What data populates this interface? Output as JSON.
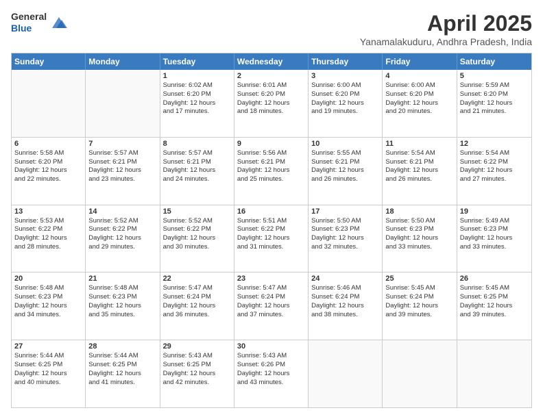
{
  "header": {
    "logo_line1": "General",
    "logo_line2": "Blue",
    "month": "April 2025",
    "location": "Yanamalakuduru, Andhra Pradesh, India"
  },
  "days_of_week": [
    "Sunday",
    "Monday",
    "Tuesday",
    "Wednesday",
    "Thursday",
    "Friday",
    "Saturday"
  ],
  "weeks": [
    [
      {
        "day": "",
        "empty": true
      },
      {
        "day": "",
        "empty": true
      },
      {
        "day": "1",
        "sunrise": "Sunrise: 6:02 AM",
        "sunset": "Sunset: 6:20 PM",
        "daylight": "Daylight: 12 hours and 17 minutes."
      },
      {
        "day": "2",
        "sunrise": "Sunrise: 6:01 AM",
        "sunset": "Sunset: 6:20 PM",
        "daylight": "Daylight: 12 hours and 18 minutes."
      },
      {
        "day": "3",
        "sunrise": "Sunrise: 6:00 AM",
        "sunset": "Sunset: 6:20 PM",
        "daylight": "Daylight: 12 hours and 19 minutes."
      },
      {
        "day": "4",
        "sunrise": "Sunrise: 6:00 AM",
        "sunset": "Sunset: 6:20 PM",
        "daylight": "Daylight: 12 hours and 20 minutes."
      },
      {
        "day": "5",
        "sunrise": "Sunrise: 5:59 AM",
        "sunset": "Sunset: 6:20 PM",
        "daylight": "Daylight: 12 hours and 21 minutes."
      }
    ],
    [
      {
        "day": "6",
        "sunrise": "Sunrise: 5:58 AM",
        "sunset": "Sunset: 6:20 PM",
        "daylight": "Daylight: 12 hours and 22 minutes."
      },
      {
        "day": "7",
        "sunrise": "Sunrise: 5:57 AM",
        "sunset": "Sunset: 6:21 PM",
        "daylight": "Daylight: 12 hours and 23 minutes."
      },
      {
        "day": "8",
        "sunrise": "Sunrise: 5:57 AM",
        "sunset": "Sunset: 6:21 PM",
        "daylight": "Daylight: 12 hours and 24 minutes."
      },
      {
        "day": "9",
        "sunrise": "Sunrise: 5:56 AM",
        "sunset": "Sunset: 6:21 PM",
        "daylight": "Daylight: 12 hours and 25 minutes."
      },
      {
        "day": "10",
        "sunrise": "Sunrise: 5:55 AM",
        "sunset": "Sunset: 6:21 PM",
        "daylight": "Daylight: 12 hours and 26 minutes."
      },
      {
        "day": "11",
        "sunrise": "Sunrise: 5:54 AM",
        "sunset": "Sunset: 6:21 PM",
        "daylight": "Daylight: 12 hours and 26 minutes."
      },
      {
        "day": "12",
        "sunrise": "Sunrise: 5:54 AM",
        "sunset": "Sunset: 6:22 PM",
        "daylight": "Daylight: 12 hours and 27 minutes."
      }
    ],
    [
      {
        "day": "13",
        "sunrise": "Sunrise: 5:53 AM",
        "sunset": "Sunset: 6:22 PM",
        "daylight": "Daylight: 12 hours and 28 minutes."
      },
      {
        "day": "14",
        "sunrise": "Sunrise: 5:52 AM",
        "sunset": "Sunset: 6:22 PM",
        "daylight": "Daylight: 12 hours and 29 minutes."
      },
      {
        "day": "15",
        "sunrise": "Sunrise: 5:52 AM",
        "sunset": "Sunset: 6:22 PM",
        "daylight": "Daylight: 12 hours and 30 minutes."
      },
      {
        "day": "16",
        "sunrise": "Sunrise: 5:51 AM",
        "sunset": "Sunset: 6:22 PM",
        "daylight": "Daylight: 12 hours and 31 minutes."
      },
      {
        "day": "17",
        "sunrise": "Sunrise: 5:50 AM",
        "sunset": "Sunset: 6:23 PM",
        "daylight": "Daylight: 12 hours and 32 minutes."
      },
      {
        "day": "18",
        "sunrise": "Sunrise: 5:50 AM",
        "sunset": "Sunset: 6:23 PM",
        "daylight": "Daylight: 12 hours and 33 minutes."
      },
      {
        "day": "19",
        "sunrise": "Sunrise: 5:49 AM",
        "sunset": "Sunset: 6:23 PM",
        "daylight": "Daylight: 12 hours and 33 minutes."
      }
    ],
    [
      {
        "day": "20",
        "sunrise": "Sunrise: 5:48 AM",
        "sunset": "Sunset: 6:23 PM",
        "daylight": "Daylight: 12 hours and 34 minutes."
      },
      {
        "day": "21",
        "sunrise": "Sunrise: 5:48 AM",
        "sunset": "Sunset: 6:23 PM",
        "daylight": "Daylight: 12 hours and 35 minutes."
      },
      {
        "day": "22",
        "sunrise": "Sunrise: 5:47 AM",
        "sunset": "Sunset: 6:24 PM",
        "daylight": "Daylight: 12 hours and 36 minutes."
      },
      {
        "day": "23",
        "sunrise": "Sunrise: 5:47 AM",
        "sunset": "Sunset: 6:24 PM",
        "daylight": "Daylight: 12 hours and 37 minutes."
      },
      {
        "day": "24",
        "sunrise": "Sunrise: 5:46 AM",
        "sunset": "Sunset: 6:24 PM",
        "daylight": "Daylight: 12 hours and 38 minutes."
      },
      {
        "day": "25",
        "sunrise": "Sunrise: 5:45 AM",
        "sunset": "Sunset: 6:24 PM",
        "daylight": "Daylight: 12 hours and 39 minutes."
      },
      {
        "day": "26",
        "sunrise": "Sunrise: 5:45 AM",
        "sunset": "Sunset: 6:25 PM",
        "daylight": "Daylight: 12 hours and 39 minutes."
      }
    ],
    [
      {
        "day": "27",
        "sunrise": "Sunrise: 5:44 AM",
        "sunset": "Sunset: 6:25 PM",
        "daylight": "Daylight: 12 hours and 40 minutes."
      },
      {
        "day": "28",
        "sunrise": "Sunrise: 5:44 AM",
        "sunset": "Sunset: 6:25 PM",
        "daylight": "Daylight: 12 hours and 41 minutes."
      },
      {
        "day": "29",
        "sunrise": "Sunrise: 5:43 AM",
        "sunset": "Sunset: 6:25 PM",
        "daylight": "Daylight: 12 hours and 42 minutes."
      },
      {
        "day": "30",
        "sunrise": "Sunrise: 5:43 AM",
        "sunset": "Sunset: 6:26 PM",
        "daylight": "Daylight: 12 hours and 43 minutes."
      },
      {
        "day": "",
        "empty": true
      },
      {
        "day": "",
        "empty": true
      },
      {
        "day": "",
        "empty": true
      }
    ]
  ]
}
